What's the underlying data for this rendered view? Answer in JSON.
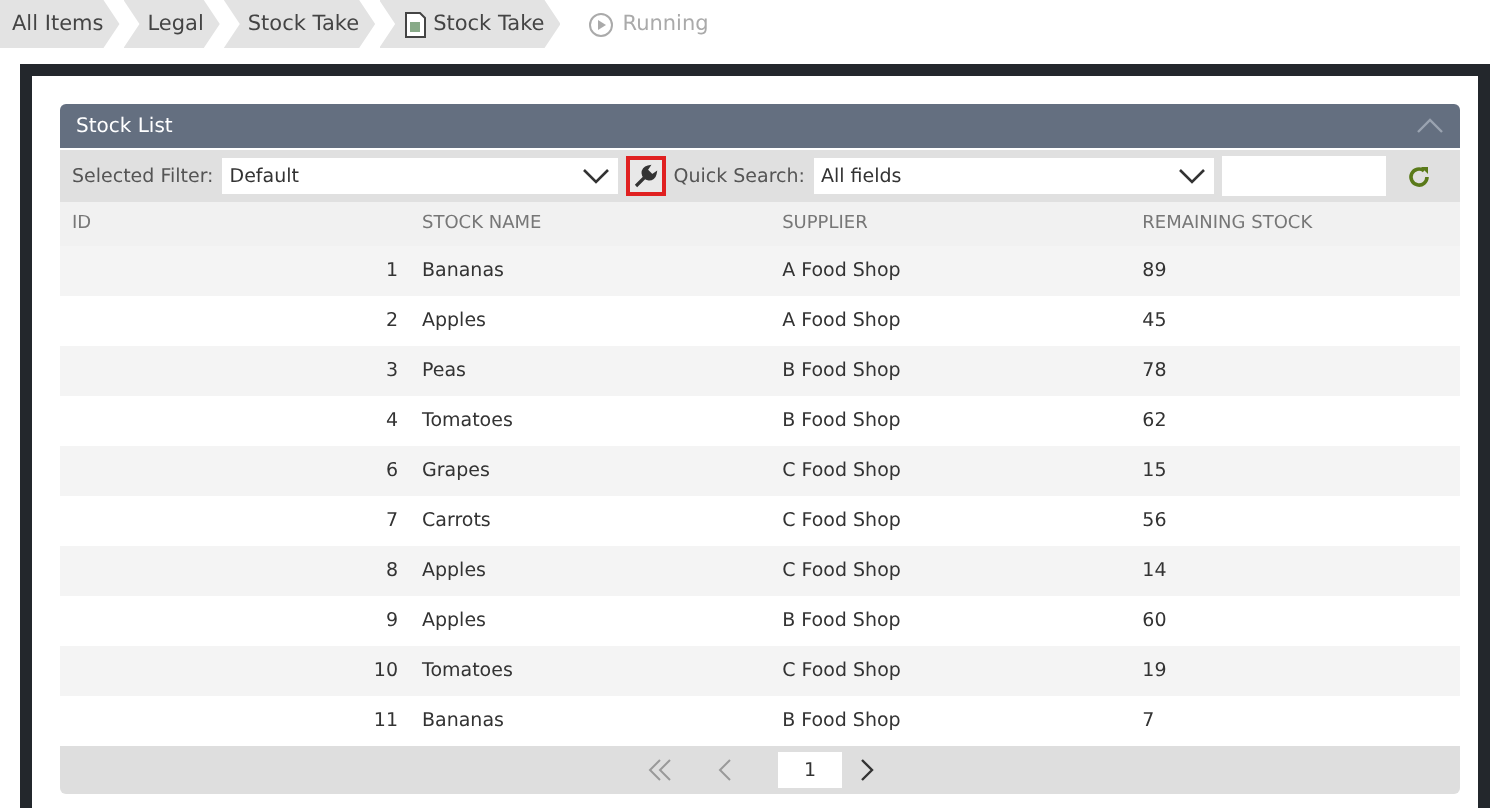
{
  "breadcrumb": [
    {
      "label": "All Items",
      "kind": "plain"
    },
    {
      "label": "Legal",
      "kind": "plain"
    },
    {
      "label": "Stock Take",
      "kind": "plain"
    },
    {
      "label": "Stock Take",
      "kind": "document"
    },
    {
      "label": "Running",
      "kind": "status"
    }
  ],
  "panel": {
    "title": "Stock List",
    "filter_label": "Selected Filter:",
    "filter_value": "Default",
    "search_label": "Quick Search:",
    "search_value": "All fields"
  },
  "table": {
    "columns": [
      "ID",
      "STOCK NAME",
      "SUPPLIER",
      "REMAINING STOCK"
    ],
    "rows": [
      [
        "1",
        "Bananas",
        "A Food Shop",
        "89"
      ],
      [
        "2",
        "Apples",
        "A Food Shop",
        "45"
      ],
      [
        "3",
        "Peas",
        "B Food Shop",
        "78"
      ],
      [
        "4",
        "Tomatoes",
        "B Food Shop",
        "62"
      ],
      [
        "6",
        "Grapes",
        "C Food Shop",
        "15"
      ],
      [
        "7",
        "Carrots",
        "C Food Shop",
        "56"
      ],
      [
        "8",
        "Apples",
        "C Food Shop",
        "14"
      ],
      [
        "9",
        "Apples",
        "B Food Shop",
        "60"
      ],
      [
        "10",
        "Tomatoes",
        "C Food Shop",
        "19"
      ],
      [
        "11",
        "Bananas",
        "B Food Shop",
        "7"
      ]
    ]
  },
  "pager": {
    "page": "1"
  }
}
